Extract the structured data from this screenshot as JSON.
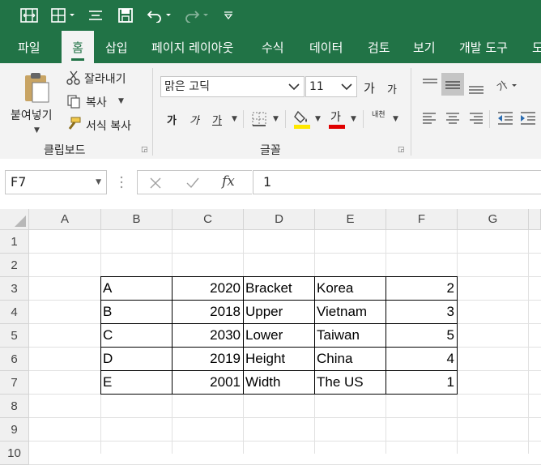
{
  "colors": {
    "brand": "#217346",
    "ribbon": "#f3f3f3",
    "font_color_bar": "#e00000",
    "fill_color_bar": "#ffe800"
  },
  "tabs": [
    "파일",
    "홈",
    "삽입",
    "페이지 레이아웃",
    "수식",
    "데이터",
    "검토",
    "보기",
    "개발 도구",
    "도"
  ],
  "clipboard": {
    "paste": "붙여넣기",
    "cut": "잘라내기",
    "copy": "복사",
    "format_painter": "서식 복사",
    "group": "클립보드"
  },
  "font": {
    "name": "맑은 고딕",
    "size": "11",
    "grow": "가",
    "shrink": "가",
    "bold": "가",
    "italic": "가",
    "underline": "가",
    "font_color_glyph": "가",
    "phonetic": "내천",
    "group": "글꼴"
  },
  "formula_bar": {
    "name_box": "F7",
    "fx": "fx",
    "value": "1"
  },
  "sheet": {
    "columns": [
      "A",
      "B",
      "C",
      "D",
      "E",
      "F",
      "G"
    ],
    "rows": [
      "1",
      "2",
      "3",
      "4",
      "5",
      "6",
      "7",
      "8",
      "9",
      "10"
    ],
    "data": [
      [
        "A",
        "2020",
        "Bracket",
        "Korea",
        "2"
      ],
      [
        "B",
        "2018",
        "Upper",
        "Vietnam",
        "3"
      ],
      [
        "C",
        "2030",
        "Lower",
        "Taiwan",
        "5"
      ],
      [
        "D",
        "2019",
        "Height",
        "China",
        "4"
      ],
      [
        "E",
        "2001",
        "Width",
        "The US",
        "1"
      ]
    ]
  }
}
